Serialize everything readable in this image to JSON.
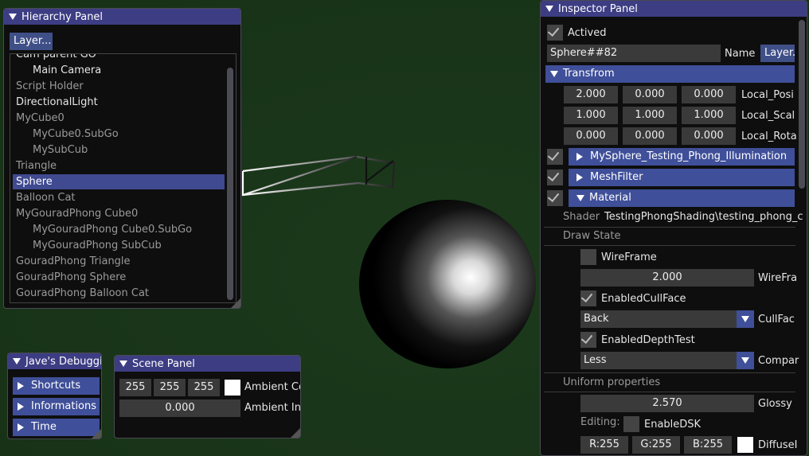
{
  "hierarchy": {
    "title": "Hierarchy Panel",
    "layer_button": "Layer...",
    "items": [
      {
        "label": "Cam parent GO"
      },
      {
        "label": "Main Camera"
      },
      {
        "label": "Script Holder"
      },
      {
        "label": "DirectionalLight"
      },
      {
        "label": "MyCube0"
      },
      {
        "label": "MyCube0.SubGo"
      },
      {
        "label": "MySubCub"
      },
      {
        "label": "Triangle"
      },
      {
        "label": "Sphere"
      },
      {
        "label": "Balloon Cat"
      },
      {
        "label": "MyGouradPhong Cube0"
      },
      {
        "label": "MyGouradPhong Cube0.SubGo"
      },
      {
        "label": "MyGouradPhong SubCub"
      },
      {
        "label": "GouradPhong Triangle"
      },
      {
        "label": "GouradPhong Sphere"
      },
      {
        "label": "GouradPhong Balloon Cat"
      }
    ]
  },
  "debug": {
    "title": "Jave's Debuggi",
    "buttons": [
      "Shortcuts",
      "Informations",
      "Time"
    ]
  },
  "scene": {
    "title": "Scene Panel",
    "ambient_r": "255",
    "ambient_g": "255",
    "ambient_b": "255",
    "ambient_color_label": "Ambient Co",
    "ambient_intensity": "0.000",
    "ambient_intensity_label": "Ambient In",
    "ambient_swatch_color": "#ffffff"
  },
  "inspector": {
    "title": "Inspector Panel",
    "actived_label": "Actived",
    "name_value": "Sphere##82",
    "name_label": "Name",
    "layer_button": "Layer..",
    "transform_header": "Transfrom",
    "position": [
      "2.000",
      "0.000",
      "0.000"
    ],
    "position_label": "Local_Posi",
    "scale": [
      "1.000",
      "1.000",
      "1.000"
    ],
    "scale_label": "Local_Scal",
    "rotation": [
      "0.000",
      "0.000",
      "0.000"
    ],
    "rotation_label": "Local_Rota",
    "components": [
      "MySphere_Testing_Phong_Illumination",
      "MeshFilter",
      "Material"
    ],
    "shader_label": "Shader",
    "shader_value": "TestingPhongShading\\testing_phong_c",
    "draw_state_label": "Draw State",
    "wireframe_label": "WireFrame",
    "wireframe_width": "2.000",
    "wireframe_width_label": "WireFra",
    "cull_label": "EnabledCullFace",
    "cull_value": "Back",
    "cull_combo_label": "CullFac",
    "depth_label": "EnabledDepthTest",
    "depth_value": "Less",
    "depth_combo_label": "Compar",
    "uniform_label": "Uniform properties",
    "glossy_value": "2.570",
    "glossy_label": "Glossy",
    "editing_label": "Editing:",
    "enable_dsk_label": "EnableDSK",
    "diffuse_r": "R:255",
    "diffuse_g": "G:255",
    "diffuse_b": "B:255",
    "diffuse_label": "DiffuseI",
    "diffuse_swatch_color": "#ffffff"
  },
  "colors": {
    "background": "#1a361a",
    "title_bar": "#3d3d84",
    "header": "#3f4f99",
    "selected": "#3f4a90"
  }
}
